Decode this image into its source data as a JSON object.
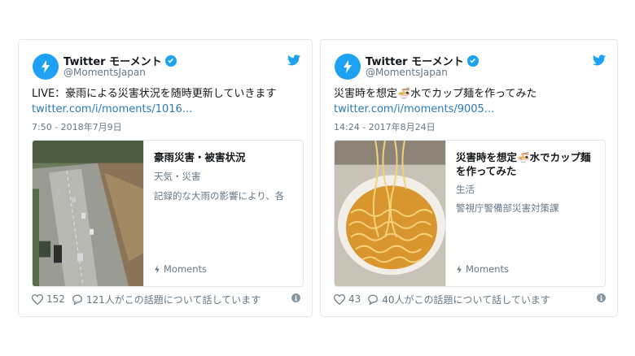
{
  "tweets": [
    {
      "account": "Twitter モーメント",
      "handle": "@MomentsJapan",
      "text": "LIVE：豪雨による災害状況を随時更新していきます",
      "link": "twitter.com/i/moments/1016...",
      "date": "7:50 - 2018年7月9日",
      "card": {
        "title": "豪雨災害・被害状況",
        "category": "天気・災害",
        "description": "記録的な大雨の影響により、各",
        "moments_label": "Moments"
      },
      "likes": "152",
      "conversation": "121人がこの話題について話しています"
    },
    {
      "account": "Twitter モーメント",
      "handle": "@MomentsJapan",
      "text": "災害時を想定🍜水でカップ麺を作ってみた",
      "link": "twitter.com/i/moments/9005...",
      "date": "14:24 - 2017年8月24日",
      "card": {
        "title": "災害時を想定🍜水でカップ麺を作ってみた",
        "category": "生活",
        "description": "警視庁警備部災害対策課",
        "moments_label": "Moments"
      },
      "likes": "43",
      "conversation": "40人がこの話題について話しています"
    }
  ],
  "colors": {
    "twitter_blue": "#1da1f2",
    "link": "#2b7bb9",
    "muted": "#657786",
    "border": "#e1e8ed"
  },
  "icons": [
    "lightning-bolt-icon",
    "verified-badge-icon",
    "twitter-bird-icon",
    "heart-icon",
    "speech-bubble-icon",
    "info-icon"
  ]
}
